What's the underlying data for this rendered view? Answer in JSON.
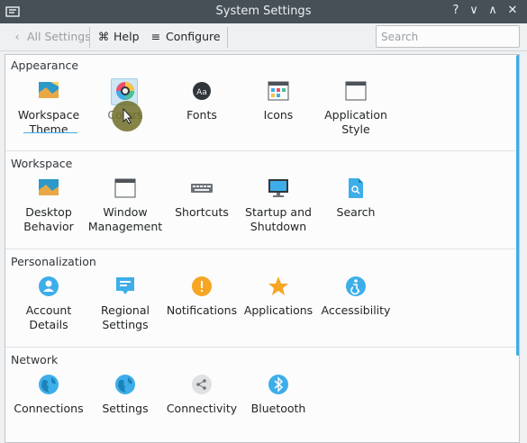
{
  "window": {
    "title": "System Settings",
    "controls": [
      "?",
      "∨",
      "∧",
      "✕"
    ]
  },
  "toolbar": {
    "all_settings": "All Settings",
    "help": "Help",
    "configure": "Configure",
    "search_placeholder": "Search"
  },
  "categories": [
    {
      "name": "Appearance",
      "items": [
        {
          "line1": "Workspace",
          "line2": "Theme",
          "icon": "workspace-theme-icon"
        },
        {
          "line1": "Colors",
          "line2": "",
          "icon": "colors-icon"
        },
        {
          "line1": "Fonts",
          "line2": "",
          "icon": "fonts-icon"
        },
        {
          "line1": "Icons",
          "line2": "",
          "icon": "icons-icon"
        },
        {
          "line1": "Application",
          "line2": "Style",
          "icon": "application-style-icon"
        }
      ]
    },
    {
      "name": "Workspace",
      "items": [
        {
          "line1": "Desktop",
          "line2": "Behavior",
          "icon": "desktop-behavior-icon"
        },
        {
          "line1": "Window",
          "line2": "Management",
          "icon": "window-management-icon"
        },
        {
          "line1": "Shortcuts",
          "line2": "",
          "icon": "keyboard-icon"
        },
        {
          "line1": "Startup and",
          "line2": "Shutdown",
          "icon": "monitor-icon"
        },
        {
          "line1": "Search",
          "line2": "",
          "icon": "search-file-icon"
        }
      ]
    },
    {
      "name": "Personalization",
      "items": [
        {
          "line1": "Account",
          "line2": "Details",
          "icon": "user-icon"
        },
        {
          "line1": "Regional",
          "line2": "Settings",
          "icon": "regional-icon"
        },
        {
          "line1": "Notifications",
          "line2": "",
          "icon": "notification-icon"
        },
        {
          "line1": "Applications",
          "line2": "",
          "icon": "star-icon"
        },
        {
          "line1": "Accessibility",
          "line2": "",
          "icon": "accessibility-icon"
        }
      ]
    },
    {
      "name": "Network",
      "items": [
        {
          "line1": "Connections",
          "line2": "",
          "icon": "globe-icon"
        },
        {
          "line1": "Settings",
          "line2": "",
          "icon": "network-settings-icon"
        },
        {
          "line1": "Connectivity",
          "line2": "",
          "icon": "share-icon"
        },
        {
          "line1": "Bluetooth",
          "line2": "",
          "icon": "bluetooth-icon"
        }
      ]
    }
  ]
}
